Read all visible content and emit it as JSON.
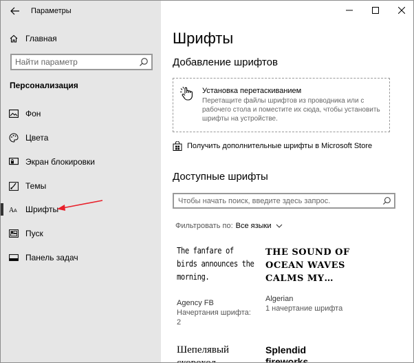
{
  "window": {
    "title": "Параметры"
  },
  "sidebar": {
    "home_label": "Главная",
    "search_placeholder": "Найти параметр",
    "section_title": "Персонализация",
    "items": [
      {
        "label": "Фон",
        "icon": "image-icon"
      },
      {
        "label": "Цвета",
        "icon": "palette-icon"
      },
      {
        "label": "Экран блокировки",
        "icon": "lock-screen-icon"
      },
      {
        "label": "Темы",
        "icon": "brush-icon"
      },
      {
        "label": "Шрифты",
        "icon": "font-icon",
        "selected": true
      },
      {
        "label": "Пуск",
        "icon": "start-icon"
      },
      {
        "label": "Панель задач",
        "icon": "taskbar-icon"
      }
    ]
  },
  "main": {
    "title": "Шрифты",
    "add_fonts_heading": "Добавление шрифтов",
    "dropzone": {
      "title": "Установка перетаскиванием",
      "description": "Перетащите файлы шрифтов из проводника или с рабочего стола и поместите их сюда, чтобы установить шрифты на устройстве."
    },
    "store_link": "Получить дополнительные шрифты в Microsoft Store",
    "available_heading": "Доступные шрифты",
    "font_search_placeholder": "Чтобы начать поиск, введите здесь запрос.",
    "filter": {
      "label": "Фильтровать по:",
      "value": "Все языки"
    },
    "fonts": [
      {
        "preview": "The fanfare of birds announces the morning.",
        "name": "Agency FB",
        "count": "Начертания шрифта: 2"
      },
      {
        "preview": "THE SOUND OF OCEAN WAVES CALMS MY…",
        "name": "Algerian",
        "count": "1 начертание шрифта"
      },
      {
        "preview": "Шепелявый скорохол",
        "name": "",
        "count": ""
      },
      {
        "preview": "Splendid fireworks",
        "name": "",
        "count": ""
      }
    ]
  },
  "colors": {
    "sidebar_bg": "#e6e6e6",
    "annotation_arrow": "#e8202a"
  }
}
